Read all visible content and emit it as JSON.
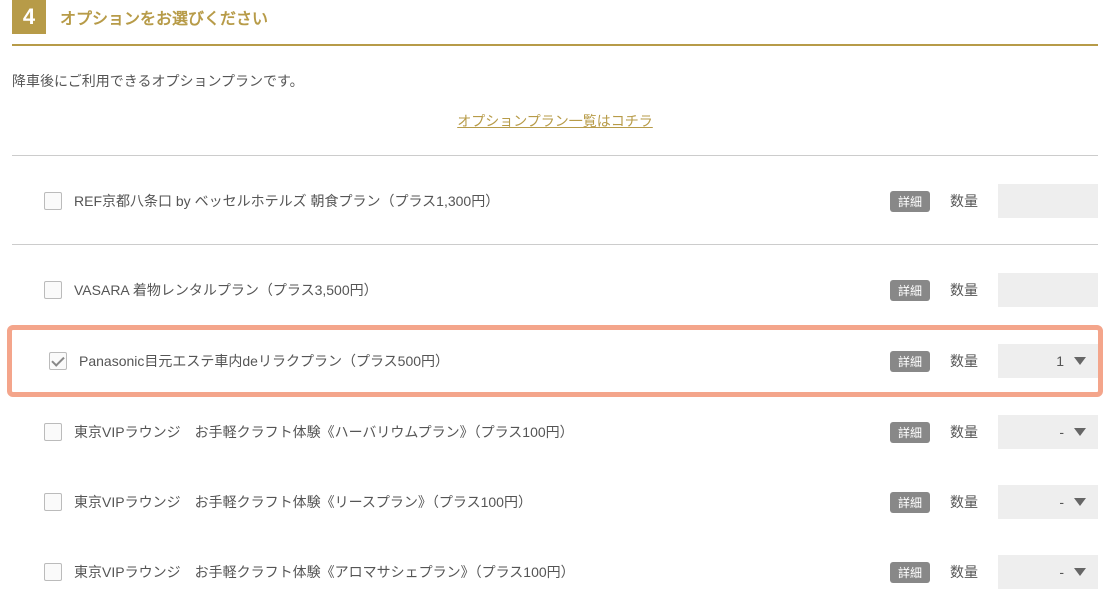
{
  "section": {
    "step_number": "4",
    "title": "オプションをお選びください",
    "description": "降車後にご利用できるオプションプランです。",
    "link_text": "オプションプラン一覧はコチラ"
  },
  "labels": {
    "detail": "詳細",
    "quantity": "数量"
  },
  "options": [
    {
      "label": "REF京都八条口 by ベッセルホテルズ 朝食プラン（プラス1,300円）",
      "checked": false,
      "qty": "",
      "show_caret": false,
      "first": true,
      "sep_after": true,
      "highlight": false
    },
    {
      "label": "VASARA 着物レンタルプラン（プラス3,500円）",
      "checked": false,
      "qty": "",
      "show_caret": false,
      "first": true,
      "sep_after": false,
      "highlight": false
    },
    {
      "label": "Panasonic目元エステ車内deリラクプラン（プラス500円）",
      "checked": true,
      "qty": "1",
      "show_caret": true,
      "first": false,
      "sep_after": false,
      "highlight": true
    },
    {
      "label": "東京VIPラウンジ　お手軽クラフト体験《ハーバリウムプラン》（プラス100円）",
      "checked": false,
      "qty": "-",
      "show_caret": true,
      "first": false,
      "sep_after": false,
      "highlight": false
    },
    {
      "label": "東京VIPラウンジ　お手軽クラフト体験《リースプラン》（プラス100円）",
      "checked": false,
      "qty": "-",
      "show_caret": true,
      "first": false,
      "sep_after": false,
      "highlight": false
    },
    {
      "label": "東京VIPラウンジ　お手軽クラフト体験《アロマサシェプラン》（プラス100円）",
      "checked": false,
      "qty": "-",
      "show_caret": true,
      "first": false,
      "sep_after": false,
      "highlight": false
    }
  ]
}
